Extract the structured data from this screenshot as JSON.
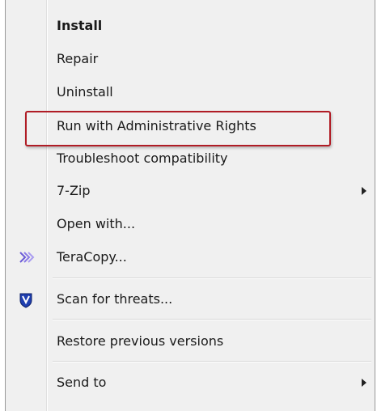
{
  "menu": {
    "items": [
      {
        "label": "Install"
      },
      {
        "label": "Repair"
      },
      {
        "label": "Uninstall"
      },
      {
        "label": "Run with Administrative Rights"
      },
      {
        "label": "Troubleshoot compatibility"
      },
      {
        "label": "7-Zip"
      },
      {
        "label": "Open with..."
      },
      {
        "label": "TeraCopy...",
        "icon": "teracopy-chevrons-icon"
      },
      {
        "label": "Scan for threats...",
        "icon": "shield-icon"
      },
      {
        "label": "Restore previous versions"
      },
      {
        "label": "Send to"
      }
    ],
    "highlight_color": "#b01c25",
    "accent_icon_color": "#1f3fb0"
  }
}
